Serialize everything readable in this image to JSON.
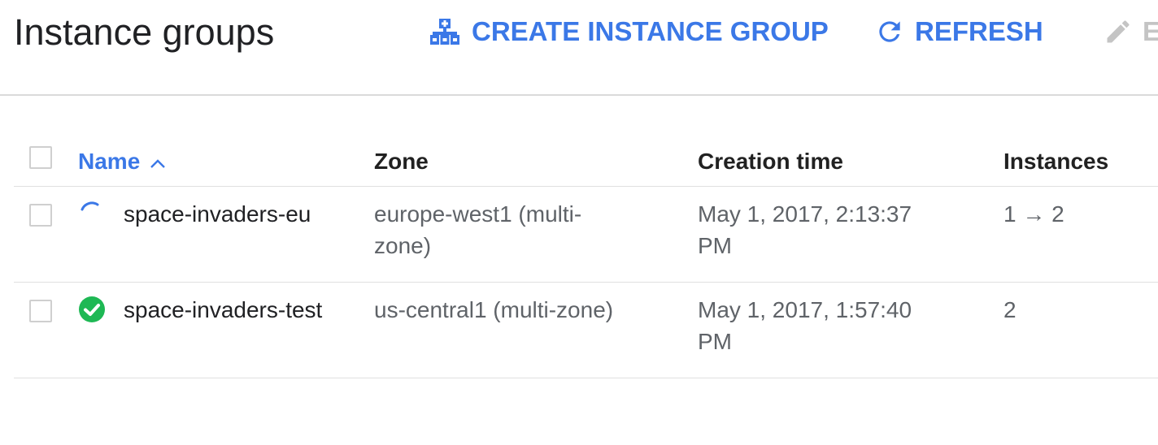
{
  "header": {
    "title": "Instance groups",
    "create_label": "CREATE INSTANCE GROUP",
    "refresh_label": "REFRESH",
    "edit_label": "E"
  },
  "table": {
    "columns": {
      "name": "Name",
      "zone": "Zone",
      "creation_time": "Creation time",
      "instances": "Instances"
    },
    "sort": {
      "column": "name",
      "direction": "ascending"
    },
    "rows": [
      {
        "status": "updating",
        "name": "space-invaders-eu",
        "zone": "europe-west1 (multi-zone)",
        "creation_time": "May 1, 2017, 2:13:37 PM",
        "instances": "1 → 2"
      },
      {
        "status": "ok",
        "name": "space-invaders-test",
        "zone": "us-central1 (multi-zone)",
        "creation_time": "May 1, 2017, 1:57:40 PM",
        "instances": "2"
      }
    ]
  },
  "colors": {
    "accent": "#3b78e7",
    "status_ok": "#1eb854",
    "disabled": "#c4c4c4",
    "secondary_text": "#5f6368",
    "divider": "#e0e0e0"
  },
  "icons": {
    "create": "create-instance-group-icon",
    "refresh": "refresh-icon",
    "edit": "edit-pencil-icon",
    "sort": "sort-ascending-icon",
    "status_updating": "loading-spinner-icon",
    "status_ok": "check-circle-icon"
  }
}
